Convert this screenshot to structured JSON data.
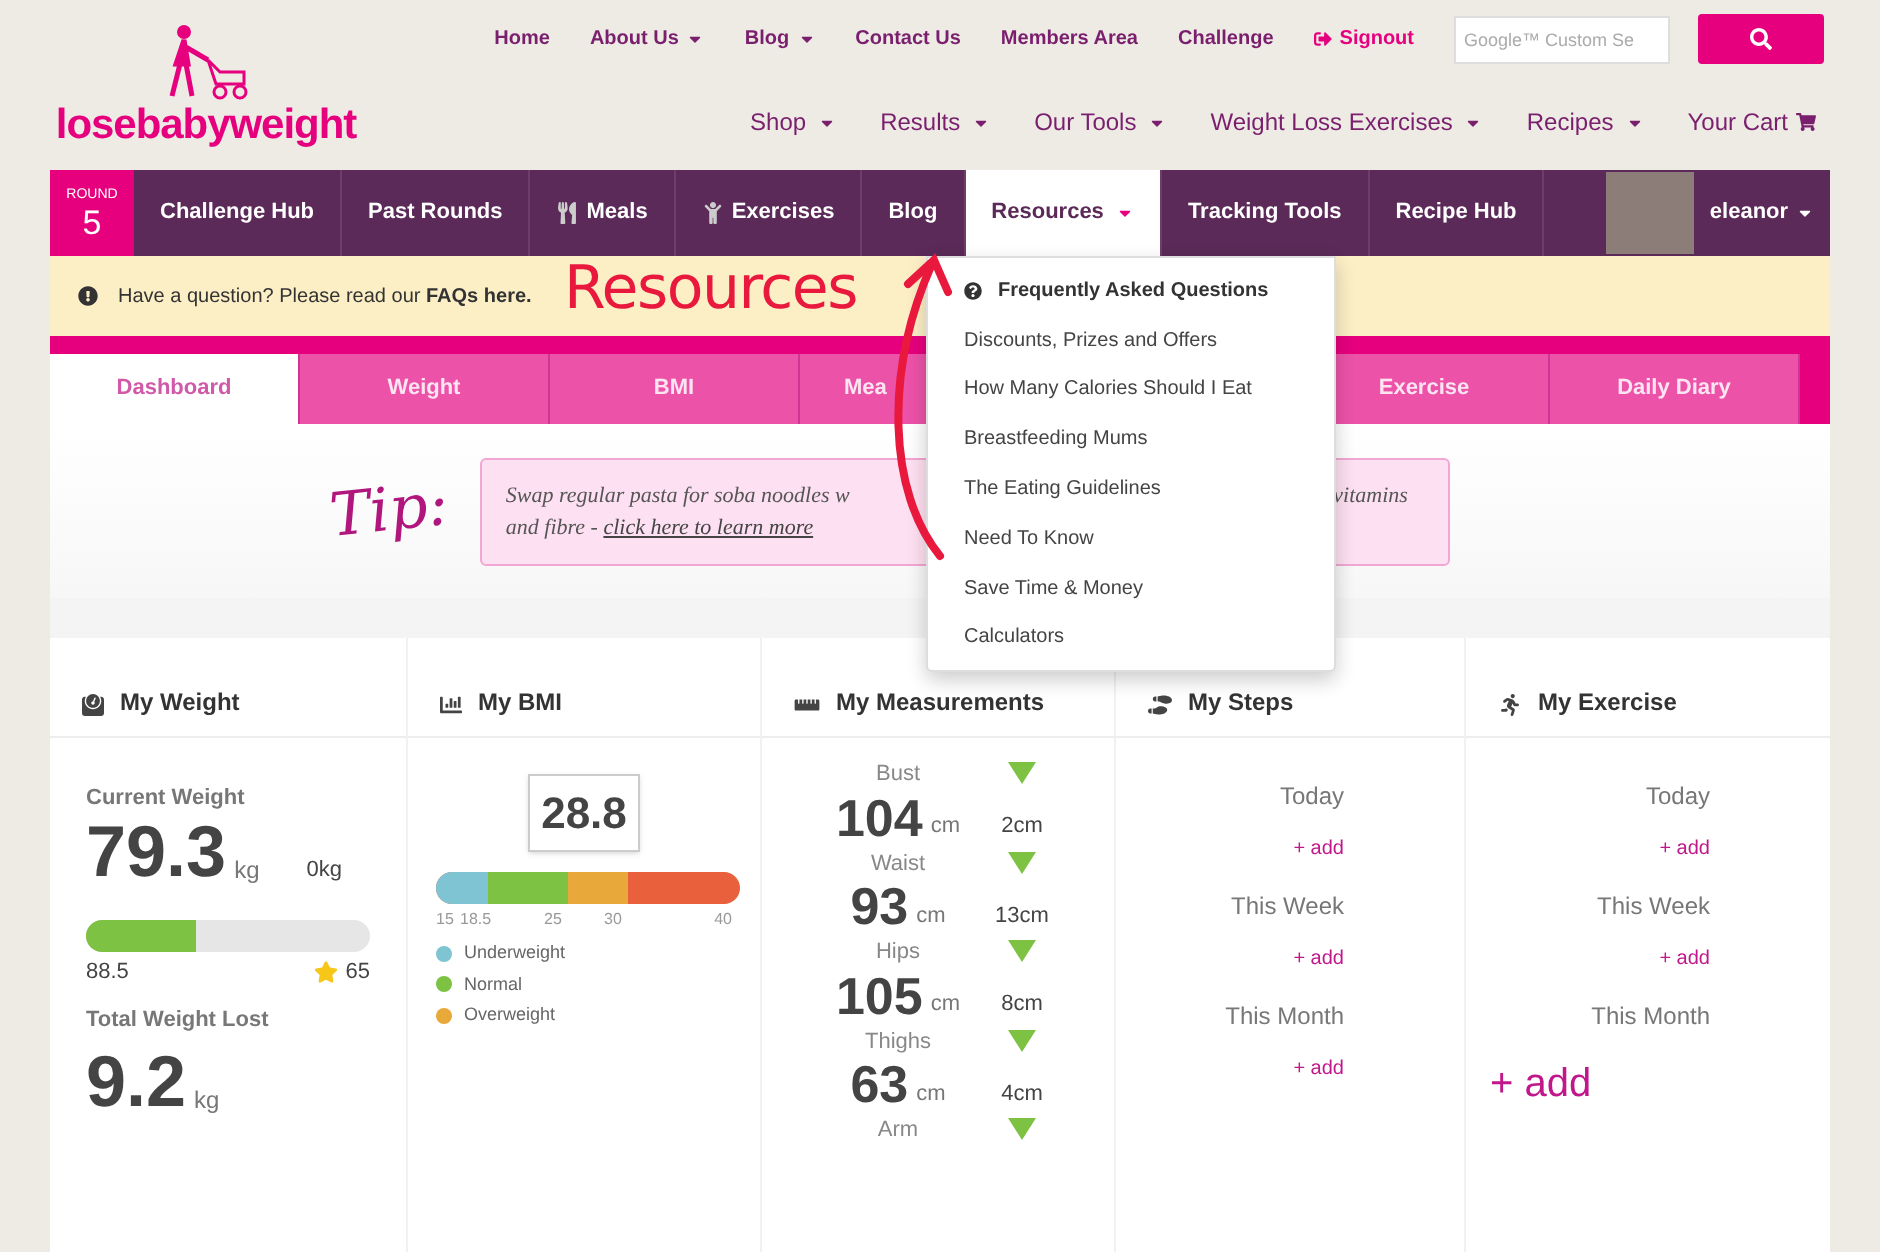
{
  "logo": {
    "text": "losebabyweight"
  },
  "top_nav": [
    {
      "label": "Home",
      "caret": false,
      "kind": "link"
    },
    {
      "label": "About Us",
      "caret": true,
      "kind": "link"
    },
    {
      "label": "Blog",
      "caret": true,
      "kind": "link"
    },
    {
      "label": "Contact Us",
      "caret": false,
      "kind": "link"
    },
    {
      "label": "Members Area",
      "caret": false,
      "kind": "link"
    },
    {
      "label": "Challenge",
      "caret": false,
      "kind": "link"
    },
    {
      "label": "Signout",
      "caret": false,
      "kind": "signout"
    }
  ],
  "search": {
    "placeholder": "Google™ Custom Se"
  },
  "shop_nav": [
    {
      "label": "Shop",
      "caret": true,
      "kind": "link"
    },
    {
      "label": "Results",
      "caret": true,
      "kind": "link"
    },
    {
      "label": "Our Tools",
      "caret": true,
      "kind": "link"
    },
    {
      "label": "Weight Loss Exercises",
      "caret": true,
      "kind": "link"
    },
    {
      "label": "Recipes",
      "caret": true,
      "kind": "link"
    },
    {
      "label": "Your Cart",
      "caret": false,
      "kind": "cart"
    }
  ],
  "main_nav": {
    "round": {
      "label": "ROUND",
      "number": "5"
    },
    "items": [
      {
        "label": "Challenge Hub",
        "kind": "plain",
        "caret": false,
        "selected": false
      },
      {
        "label": "Past Rounds",
        "kind": "plain",
        "caret": false,
        "selected": false
      },
      {
        "label": "Meals",
        "kind": "meals",
        "caret": false,
        "selected": false
      },
      {
        "label": "Exercises",
        "kind": "exercises",
        "caret": false,
        "selected": false
      },
      {
        "label": "Blog",
        "kind": "plain",
        "caret": false,
        "selected": false
      },
      {
        "label": "Resources",
        "kind": "plain",
        "caret": true,
        "selected": true
      },
      {
        "label": "Tracking Tools",
        "kind": "plain",
        "caret": false,
        "selected": false
      },
      {
        "label": "Recipe Hub",
        "kind": "plain",
        "caret": false,
        "selected": false
      }
    ],
    "user": "eleanor"
  },
  "resources_menu": [
    {
      "label": "Frequently Asked Questions",
      "kind": "header"
    },
    {
      "label": "Discounts, Prizes and Offers",
      "kind": "item"
    },
    {
      "label": "How Many Calories Should I Eat",
      "kind": "item"
    },
    {
      "label": "Breastfeeding Mums",
      "kind": "item"
    },
    {
      "label": "The Eating Guidelines",
      "kind": "item"
    },
    {
      "label": "Need To Know",
      "kind": "item"
    },
    {
      "label": "Save Time & Money",
      "kind": "item"
    },
    {
      "label": "Calculators",
      "kind": "item"
    }
  ],
  "alert": {
    "text": "Have a question? Please read our **FAQs here.**"
  },
  "annotation": {
    "text": "Resources"
  },
  "tabs": [
    {
      "label": "Dashboard",
      "selected": true
    },
    {
      "label": "Weight",
      "selected": false
    },
    {
      "label": "BMI",
      "selected": false
    },
    {
      "label": "Mea",
      "selected": false
    },
    {
      "label": "Exercise",
      "selected": false
    },
    {
      "label": "Daily Diary",
      "selected": false
    }
  ],
  "tip": {
    "label": "Tip:",
    "line1": "Swap regular pasta for soba noodles w",
    "line1_end": "vitamins",
    "line2": "and fibre - ",
    "link": "click here to learn more"
  },
  "weight": {
    "title": "My Weight",
    "current_label": "Current Weight",
    "current": "79.3",
    "unit": "kg",
    "change": "0kg",
    "level": 0.39,
    "start": "88.5",
    "goal": "65",
    "lost_label": "Total Weight Lost",
    "lost": "9.2",
    "lost_unit": "kg"
  },
  "bmi": {
    "title": "My BMI",
    "value": "28.8",
    "ticks": [
      "15",
      "18.5",
      "25",
      "30",
      "40"
    ],
    "legend": [
      {
        "label": "Underweight",
        "color": "#7ec4d2"
      },
      {
        "label": "Normal",
        "color": "#7dc242"
      },
      {
        "label": "Overweight",
        "color": "#e8a83a"
      }
    ]
  },
  "measurements": {
    "title": "My Measurements",
    "rows": [
      {
        "name": "Bust",
        "value": "104",
        "unit": "cm",
        "change": "2cm"
      },
      {
        "name": "Waist",
        "value": "93",
        "unit": "cm",
        "change": "13cm"
      },
      {
        "name": "Hips",
        "value": "105",
        "unit": "cm",
        "change": "8cm"
      },
      {
        "name": "Thighs",
        "value": "63",
        "unit": "cm",
        "change": "4cm"
      },
      {
        "name": "Arm"
      }
    ]
  },
  "steps": {
    "title": "My Steps",
    "rows": [
      {
        "label": "Today",
        "add": "+ add",
        "large": false
      },
      {
        "label": "This Week",
        "add": "+ add",
        "large": false
      },
      {
        "label": "This Month",
        "add": "+ add",
        "large": false
      }
    ]
  },
  "exercise": {
    "title": "My Exercise",
    "rows": [
      {
        "label": "Today",
        "add": "+ add",
        "large": false
      },
      {
        "label": "This Week",
        "add": "+ add",
        "large": false
      },
      {
        "label": "This Month",
        "add": "+ add",
        "large": true
      }
    ]
  }
}
